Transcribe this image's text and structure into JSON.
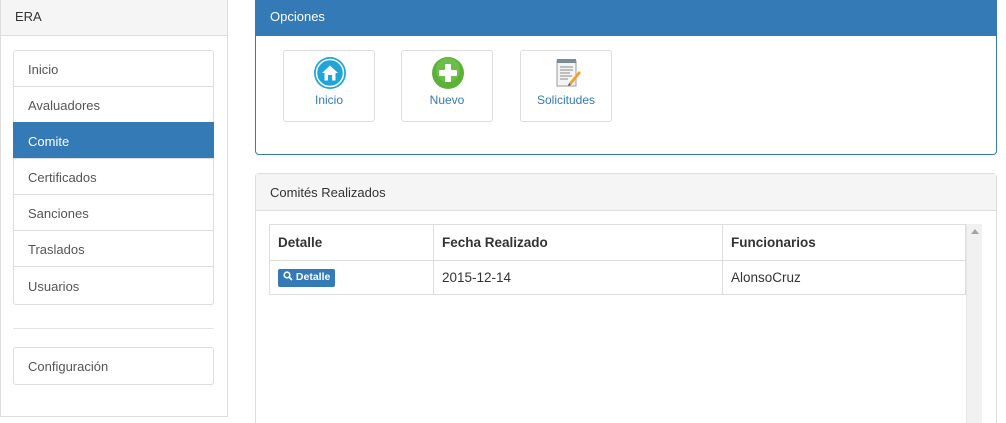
{
  "sidebar": {
    "title": "ERA",
    "items": [
      {
        "label": "Inicio"
      },
      {
        "label": "Avaluadores"
      },
      {
        "label": "Comite"
      },
      {
        "label": "Certificados"
      },
      {
        "label": "Sanciones"
      },
      {
        "label": "Traslados"
      },
      {
        "label": "Usuarios"
      }
    ],
    "active_item": "Comite",
    "config_label": "Configuración"
  },
  "options": {
    "title": "Opciones",
    "tiles": [
      {
        "label": "Inicio",
        "icon": "home-icon"
      },
      {
        "label": "Nuevo",
        "icon": "add-icon"
      },
      {
        "label": "Solicitudes",
        "icon": "document-edit-icon"
      }
    ]
  },
  "committees": {
    "title": "Comités Realizados",
    "columns": [
      "Detalle",
      "Fecha Realizado",
      "Funcionarios"
    ],
    "rows": [
      {
        "button_label": "Detalle",
        "fecha": "2015-12-14",
        "funcionarios": "AlonsoCruz"
      }
    ]
  },
  "colors": {
    "primary": "#337ab7",
    "border": "#dddddd",
    "panel_heading": "#f5f5f5",
    "home_icon": "#1fa5d8",
    "add_icon": "#5cb13b"
  }
}
